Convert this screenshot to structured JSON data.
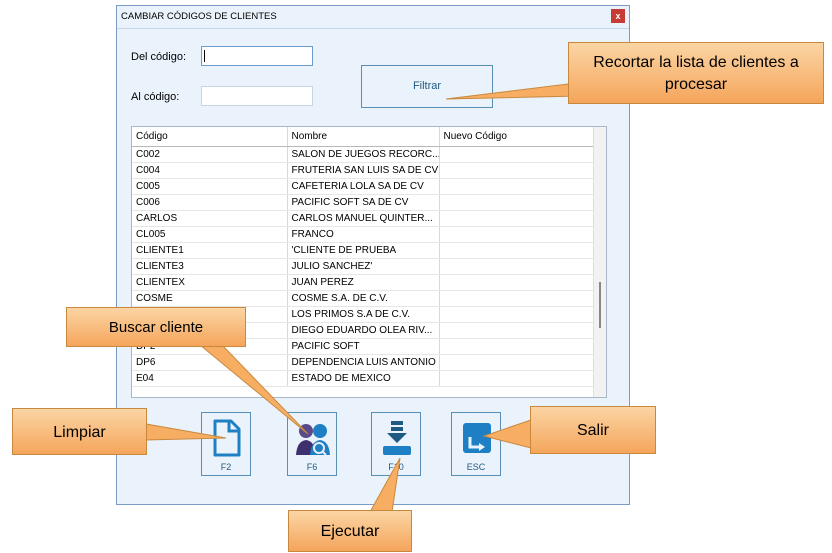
{
  "window": {
    "title": "CAMBIAR CÓDIGOS DE CLIENTES",
    "close_label": "x"
  },
  "form": {
    "from_label": "Del código:",
    "from_value": "",
    "to_label": "Al código:",
    "to_value": "",
    "filter_label": "Filtrar"
  },
  "grid": {
    "columns": [
      "Código",
      "Nombre",
      "Nuevo Código"
    ],
    "rows": [
      [
        "C002",
        "SALON DE JUEGOS RECORC...",
        ""
      ],
      [
        "C004",
        "FRUTERIA SAN LUIS SA DE CV",
        ""
      ],
      [
        "C005",
        "CAFETERIA LOLA SA DE CV",
        ""
      ],
      [
        "C006",
        "PACIFIC SOFT SA DE CV",
        ""
      ],
      [
        "CARLOS",
        "CARLOS MANUEL QUINTER...",
        ""
      ],
      [
        "CL005",
        "FRANCO",
        ""
      ],
      [
        "CLIENTE1",
        "'CLIENTE DE PRUEBA",
        ""
      ],
      [
        "CLIENTE3",
        "JULIO SANCHEZ'",
        ""
      ],
      [
        "CLIENTEX",
        "JUAN PEREZ",
        ""
      ],
      [
        "COSME",
        "COSME S.A. DE C.V.",
        ""
      ],
      [
        "",
        "LOS PRIMOS S.A DE C.V.",
        ""
      ],
      [
        "",
        "DIEGO EDUARDO OLEA RIV...",
        ""
      ],
      [
        "DP2",
        "PACIFIC SOFT",
        ""
      ],
      [
        "DP6",
        "DEPENDENCIA LUIS ANTONIO",
        ""
      ],
      [
        "E04",
        "ESTADO DE MEXICO",
        ""
      ]
    ]
  },
  "buttons": [
    {
      "key": "F2",
      "icon": "document-icon"
    },
    {
      "key": "F6",
      "icon": "users-icon"
    },
    {
      "key": "F10",
      "icon": "download-icon"
    },
    {
      "key": "ESC",
      "icon": "exit-icon"
    }
  ],
  "callouts": {
    "filter": "Recortar la lista de clientes a procesar",
    "search": "Buscar cliente",
    "clear": "Limpiar",
    "run": "Ejecutar",
    "exit": "Salir"
  },
  "colors": {
    "accent": "#1f5a84",
    "callout": "#f8b46c",
    "close": "#c83b35"
  }
}
